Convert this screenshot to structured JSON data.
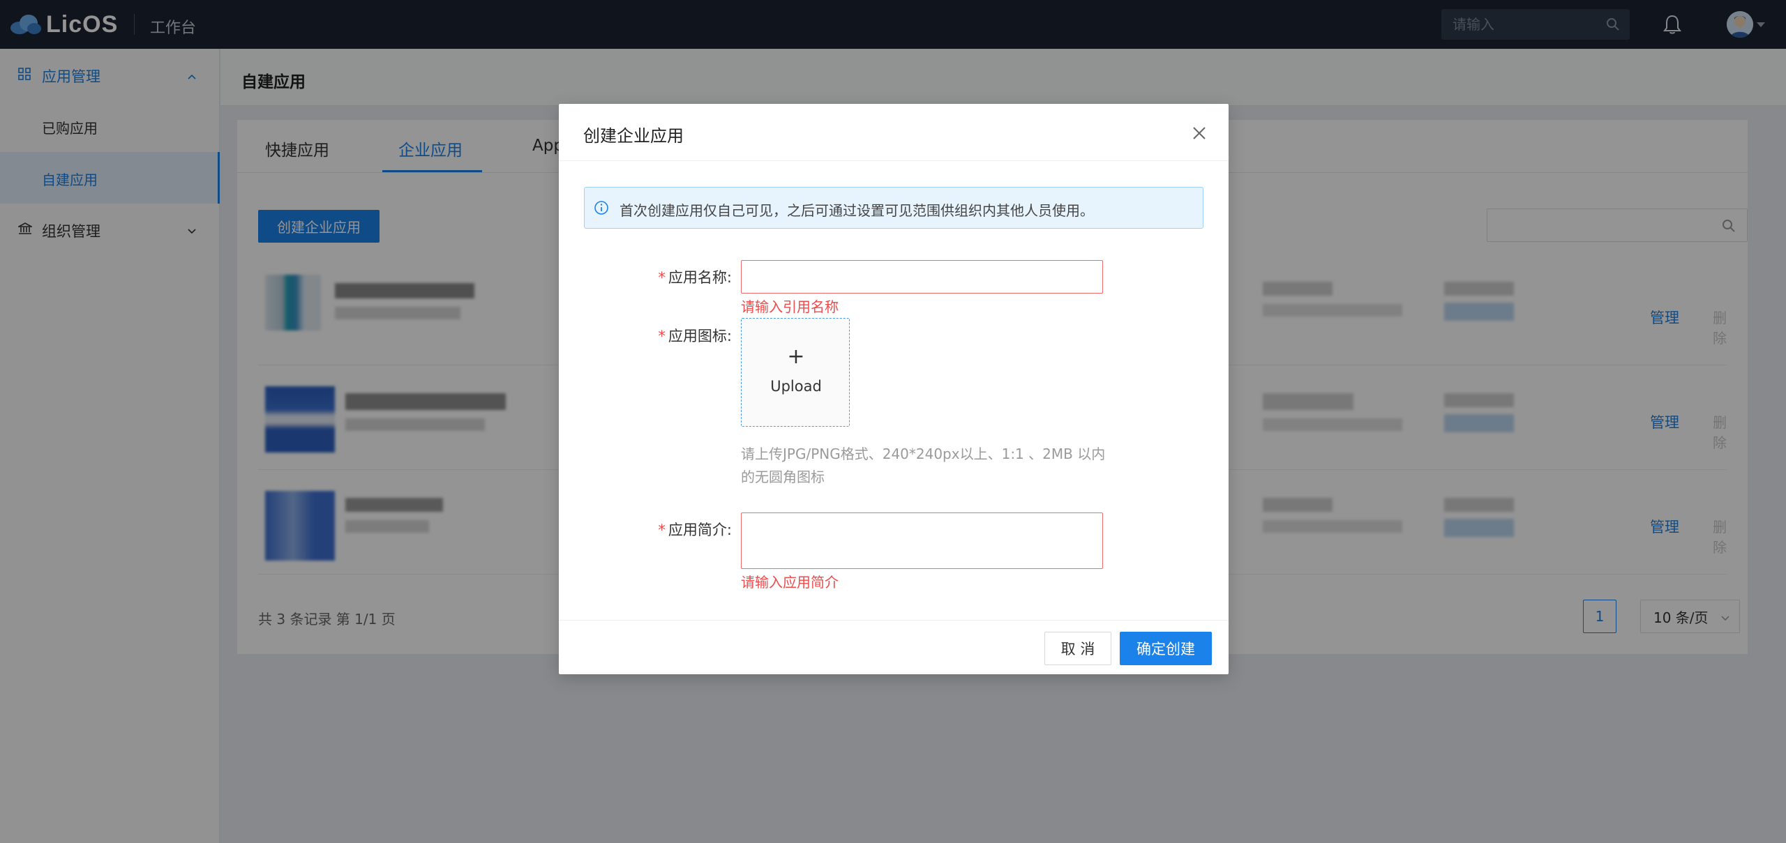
{
  "header": {
    "logo_text": "LicOS",
    "workbench": "工作台",
    "search_placeholder": "请输入"
  },
  "sidebar": {
    "groups": [
      {
        "label": "应用管理",
        "expanded": true,
        "icon": "grid-icon"
      },
      {
        "label": "组织管理",
        "expanded": false,
        "icon": "bank-icon"
      }
    ],
    "items": [
      {
        "label": "已购应用",
        "active": false
      },
      {
        "label": "自建应用",
        "active": true
      }
    ]
  },
  "main": {
    "title": "自建应用",
    "tabs": [
      {
        "label": "快捷应用",
        "active": false
      },
      {
        "label": "企业应用",
        "active": true
      },
      {
        "label": "App",
        "active": false
      }
    ],
    "create_button": "创建企业应用",
    "rows": [
      {
        "manage": "管理",
        "delete": "删除"
      },
      {
        "manage": "管理",
        "delete": "删除"
      },
      {
        "manage": "管理",
        "delete": "删除"
      }
    ],
    "footer_total": "共 3 条记录 第 1/1 页",
    "current_page": "1",
    "page_size": "10 条/页"
  },
  "modal": {
    "title": "创建企业应用",
    "alert": "首次创建应用仅自己可见，之后可通过设置可见范围供组织内其他人员使用。",
    "name_label": "应用名称:",
    "name_value": "",
    "name_error": "请输入引用名称",
    "icon_label": "应用图标:",
    "upload_plus": "+",
    "upload_text": "Upload",
    "upload_hint": "请上传JPG/PNG格式、240*240px以上、1:1 、2MB 以内的无圆角图标",
    "intro_label": "应用简介:",
    "intro_value": "",
    "intro_error": "请输入应用简介",
    "cancel": "取 消",
    "confirm": "确定创建"
  },
  "colors": {
    "accent": "#1a82e8",
    "error": "#f04a4a",
    "topbar": "#1b2433"
  }
}
